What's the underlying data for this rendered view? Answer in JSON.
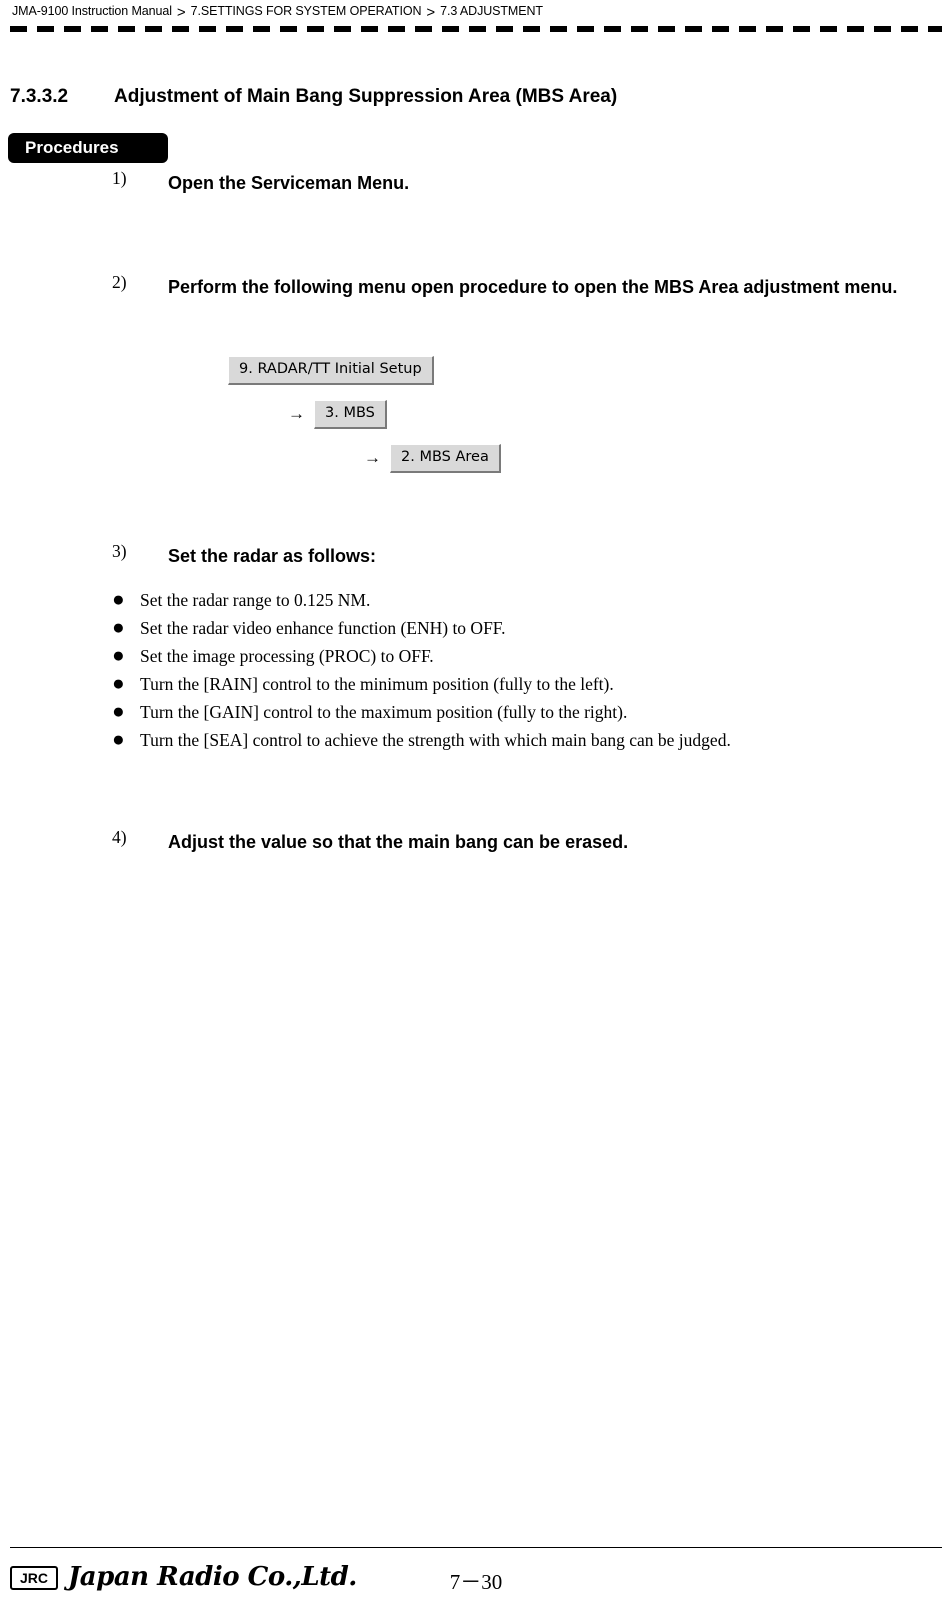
{
  "header": {
    "crumb1": "JMA-9100 Instruction Manual",
    "sep1": ">",
    "crumb2": "7.SETTINGS FOR SYSTEM OPERATION",
    "sep2": ">",
    "crumb3": "7.3  ADJUSTMENT"
  },
  "section": {
    "number": "7.3.3.2",
    "title": "Adjustment of Main Bang Suppression Area (MBS Area)"
  },
  "procedures_badge": "Procedures",
  "steps": [
    {
      "marker": "1)",
      "text": "Open the Serviceman Menu."
    },
    {
      "marker": "2)",
      "text": "Perform the following menu open procedure to open the MBS Area adjustment menu."
    },
    {
      "marker": "3)",
      "text": "Set the radar as follows:"
    },
    {
      "marker": "4)",
      "text": "Adjust the value so that the main bang can be erased."
    }
  ],
  "menu_path": {
    "arrow": "→",
    "items": [
      "9. RADAR/TT Initial Setup",
      "3. MBS",
      "2. MBS Area"
    ]
  },
  "bullets": [
    {
      "dot": "●",
      "text": "Set the radar range to 0.125 NM."
    },
    {
      "dot": "●",
      "text": "Set the radar video enhance function (ENH) to OFF."
    },
    {
      "dot": "●",
      "text": "Set the image processing (PROC) to OFF."
    },
    {
      "dot": "●",
      "text": "Turn the [RAIN] control to the minimum position (fully to the left)."
    },
    {
      "dot": "●",
      "text": "Turn the [GAIN] control to the maximum position (fully to the right)."
    },
    {
      "dot": "●",
      "text": "Turn the [SEA] control to achieve the strength with which main bang can be judged."
    }
  ],
  "footer": {
    "logo_text": "JRC",
    "wordmark": "Japan Radio Co.,Ltd.",
    "page_number": "7－30"
  }
}
